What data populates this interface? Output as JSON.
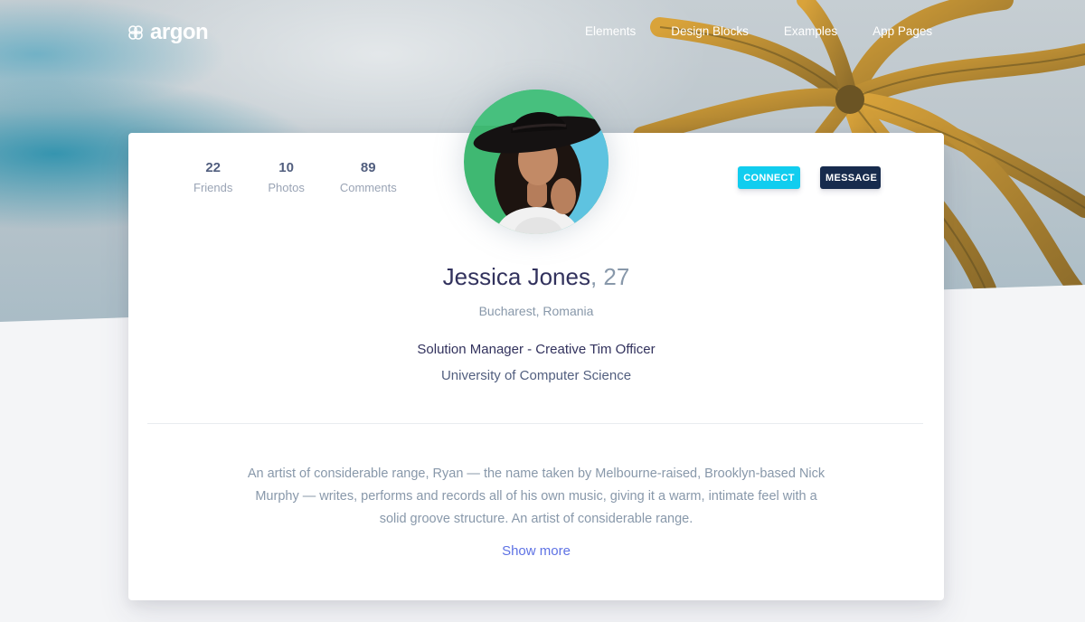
{
  "navbar": {
    "brand": "argon",
    "links": [
      "Elements",
      "Design Blocks",
      "Examples",
      "App Pages"
    ]
  },
  "profile": {
    "stats": [
      {
        "value": "22",
        "label": "Friends"
      },
      {
        "value": "10",
        "label": "Photos"
      },
      {
        "value": "89",
        "label": "Comments"
      }
    ],
    "actions": {
      "connect": "CONNECT",
      "message": "MESSAGE"
    },
    "name": "Jessica Jones",
    "age_suffix": ", 27",
    "location": "Bucharest, Romania",
    "job": "Solution Manager - Creative Tim Officer",
    "school": "University of Computer Science",
    "bio": "An artist of considerable range, Ryan — the name taken by Melbourne-raised, Brooklyn-based Nick Murphy — writes, performs and records all of his own music, giving it a warm, intimate feel with a solid groove structure. An artist of considerable range.",
    "show_more": "Show more"
  },
  "colors": {
    "connect": "#11cdef",
    "message": "#172b4d",
    "link": "#5e72e4",
    "heading": "#32325d",
    "muted": "#8898aa"
  },
  "icons": [
    "argon-logo-icon",
    "avatar-photo"
  ]
}
